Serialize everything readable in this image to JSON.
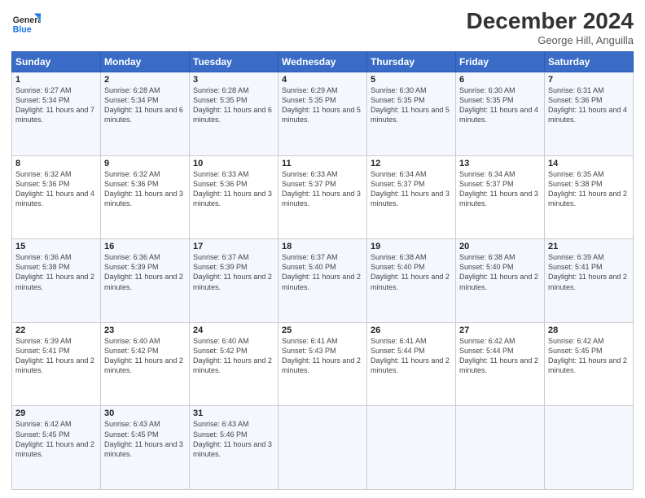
{
  "header": {
    "logo_line1": "General",
    "logo_line2": "Blue",
    "month": "December 2024",
    "location": "George Hill, Anguilla"
  },
  "weekdays": [
    "Sunday",
    "Monday",
    "Tuesday",
    "Wednesday",
    "Thursday",
    "Friday",
    "Saturday"
  ],
  "weeks": [
    [
      {
        "day": "1",
        "sunrise": "6:27 AM",
        "sunset": "5:34 PM",
        "daylight": "11 hours and 7 minutes."
      },
      {
        "day": "2",
        "sunrise": "6:28 AM",
        "sunset": "5:34 PM",
        "daylight": "11 hours and 6 minutes."
      },
      {
        "day": "3",
        "sunrise": "6:28 AM",
        "sunset": "5:35 PM",
        "daylight": "11 hours and 6 minutes."
      },
      {
        "day": "4",
        "sunrise": "6:29 AM",
        "sunset": "5:35 PM",
        "daylight": "11 hours and 5 minutes."
      },
      {
        "day": "5",
        "sunrise": "6:30 AM",
        "sunset": "5:35 PM",
        "daylight": "11 hours and 5 minutes."
      },
      {
        "day": "6",
        "sunrise": "6:30 AM",
        "sunset": "5:35 PM",
        "daylight": "11 hours and 4 minutes."
      },
      {
        "day": "7",
        "sunrise": "6:31 AM",
        "sunset": "5:36 PM",
        "daylight": "11 hours and 4 minutes."
      }
    ],
    [
      {
        "day": "8",
        "sunrise": "6:32 AM",
        "sunset": "5:36 PM",
        "daylight": "11 hours and 4 minutes."
      },
      {
        "day": "9",
        "sunrise": "6:32 AM",
        "sunset": "5:36 PM",
        "daylight": "11 hours and 3 minutes."
      },
      {
        "day": "10",
        "sunrise": "6:33 AM",
        "sunset": "5:36 PM",
        "daylight": "11 hours and 3 minutes."
      },
      {
        "day": "11",
        "sunrise": "6:33 AM",
        "sunset": "5:37 PM",
        "daylight": "11 hours and 3 minutes."
      },
      {
        "day": "12",
        "sunrise": "6:34 AM",
        "sunset": "5:37 PM",
        "daylight": "11 hours and 3 minutes."
      },
      {
        "day": "13",
        "sunrise": "6:34 AM",
        "sunset": "5:37 PM",
        "daylight": "11 hours and 3 minutes."
      },
      {
        "day": "14",
        "sunrise": "6:35 AM",
        "sunset": "5:38 PM",
        "daylight": "11 hours and 2 minutes."
      }
    ],
    [
      {
        "day": "15",
        "sunrise": "6:36 AM",
        "sunset": "5:38 PM",
        "daylight": "11 hours and 2 minutes."
      },
      {
        "day": "16",
        "sunrise": "6:36 AM",
        "sunset": "5:39 PM",
        "daylight": "11 hours and 2 minutes."
      },
      {
        "day": "17",
        "sunrise": "6:37 AM",
        "sunset": "5:39 PM",
        "daylight": "11 hours and 2 minutes."
      },
      {
        "day": "18",
        "sunrise": "6:37 AM",
        "sunset": "5:40 PM",
        "daylight": "11 hours and 2 minutes."
      },
      {
        "day": "19",
        "sunrise": "6:38 AM",
        "sunset": "5:40 PM",
        "daylight": "11 hours and 2 minutes."
      },
      {
        "day": "20",
        "sunrise": "6:38 AM",
        "sunset": "5:40 PM",
        "daylight": "11 hours and 2 minutes."
      },
      {
        "day": "21",
        "sunrise": "6:39 AM",
        "sunset": "5:41 PM",
        "daylight": "11 hours and 2 minutes."
      }
    ],
    [
      {
        "day": "22",
        "sunrise": "6:39 AM",
        "sunset": "5:41 PM",
        "daylight": "11 hours and 2 minutes."
      },
      {
        "day": "23",
        "sunrise": "6:40 AM",
        "sunset": "5:42 PM",
        "daylight": "11 hours and 2 minutes."
      },
      {
        "day": "24",
        "sunrise": "6:40 AM",
        "sunset": "5:42 PM",
        "daylight": "11 hours and 2 minutes."
      },
      {
        "day": "25",
        "sunrise": "6:41 AM",
        "sunset": "5:43 PM",
        "daylight": "11 hours and 2 minutes."
      },
      {
        "day": "26",
        "sunrise": "6:41 AM",
        "sunset": "5:44 PM",
        "daylight": "11 hours and 2 minutes."
      },
      {
        "day": "27",
        "sunrise": "6:42 AM",
        "sunset": "5:44 PM",
        "daylight": "11 hours and 2 minutes."
      },
      {
        "day": "28",
        "sunrise": "6:42 AM",
        "sunset": "5:45 PM",
        "daylight": "11 hours and 2 minutes."
      }
    ],
    [
      {
        "day": "29",
        "sunrise": "6:42 AM",
        "sunset": "5:45 PM",
        "daylight": "11 hours and 2 minutes."
      },
      {
        "day": "30",
        "sunrise": "6:43 AM",
        "sunset": "5:45 PM",
        "daylight": "11 hours and 3 minutes."
      },
      {
        "day": "31",
        "sunrise": "6:43 AM",
        "sunset": "5:46 PM",
        "daylight": "11 hours and 3 minutes."
      },
      null,
      null,
      null,
      null
    ]
  ]
}
